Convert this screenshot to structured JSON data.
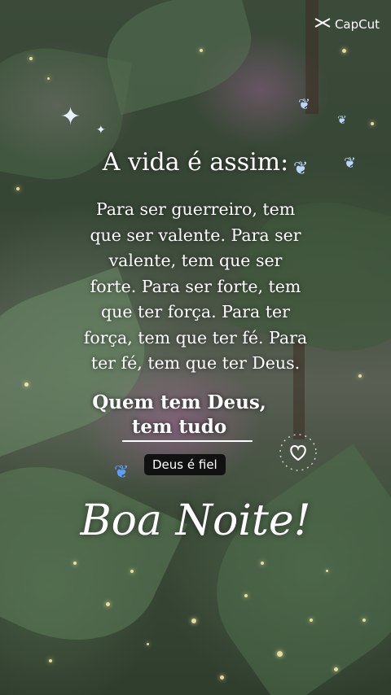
{
  "logo": {
    "text": "CapCut",
    "icon": "capcut-logo-icon"
  },
  "title": "A vida é assim:",
  "body_lines": [
    "Para ser guerreiro, tem",
    "que ser valente. Para ser",
    "valente, tem que ser",
    "forte. Para ser forte, tem",
    "que ter força. Para ter",
    "força, tem que ter fé. Para",
    "ter fé, tem que ter Deus."
  ],
  "highlight_lines": [
    "Quem tem Deus,",
    "tem tudo"
  ],
  "badge": "Deus é fiel",
  "greeting": "Boa Noite!",
  "colors": {
    "text": "#ffffff",
    "badge_bg": "#111111"
  }
}
